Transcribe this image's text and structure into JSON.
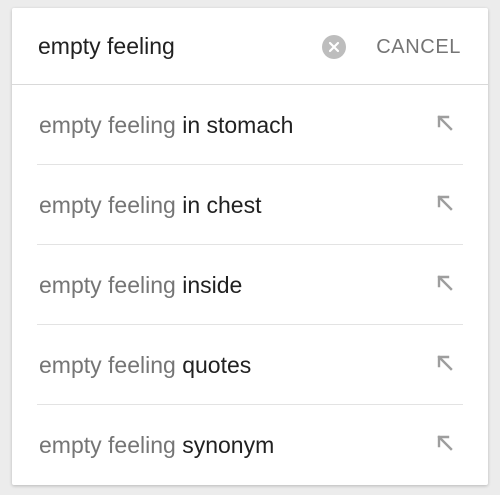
{
  "search": {
    "query": "empty feeling",
    "cancel_label": "CANCEL"
  },
  "suggestions": [
    {
      "prefix": "empty feeling",
      "completion": "in stomach"
    },
    {
      "prefix": "empty feeling",
      "completion": "in chest"
    },
    {
      "prefix": "empty feeling",
      "completion": "inside"
    },
    {
      "prefix": "empty feeling",
      "completion": "quotes"
    },
    {
      "prefix": "empty feeling",
      "completion": "synonym"
    }
  ],
  "icons": {
    "clear": "clear-icon",
    "fill_query": "arrow-up-left-icon"
  },
  "colors": {
    "background": "#ececec",
    "card": "#ffffff",
    "query_text": "#212121",
    "secondary_text": "#757575",
    "icon": "#9e9e9e"
  }
}
